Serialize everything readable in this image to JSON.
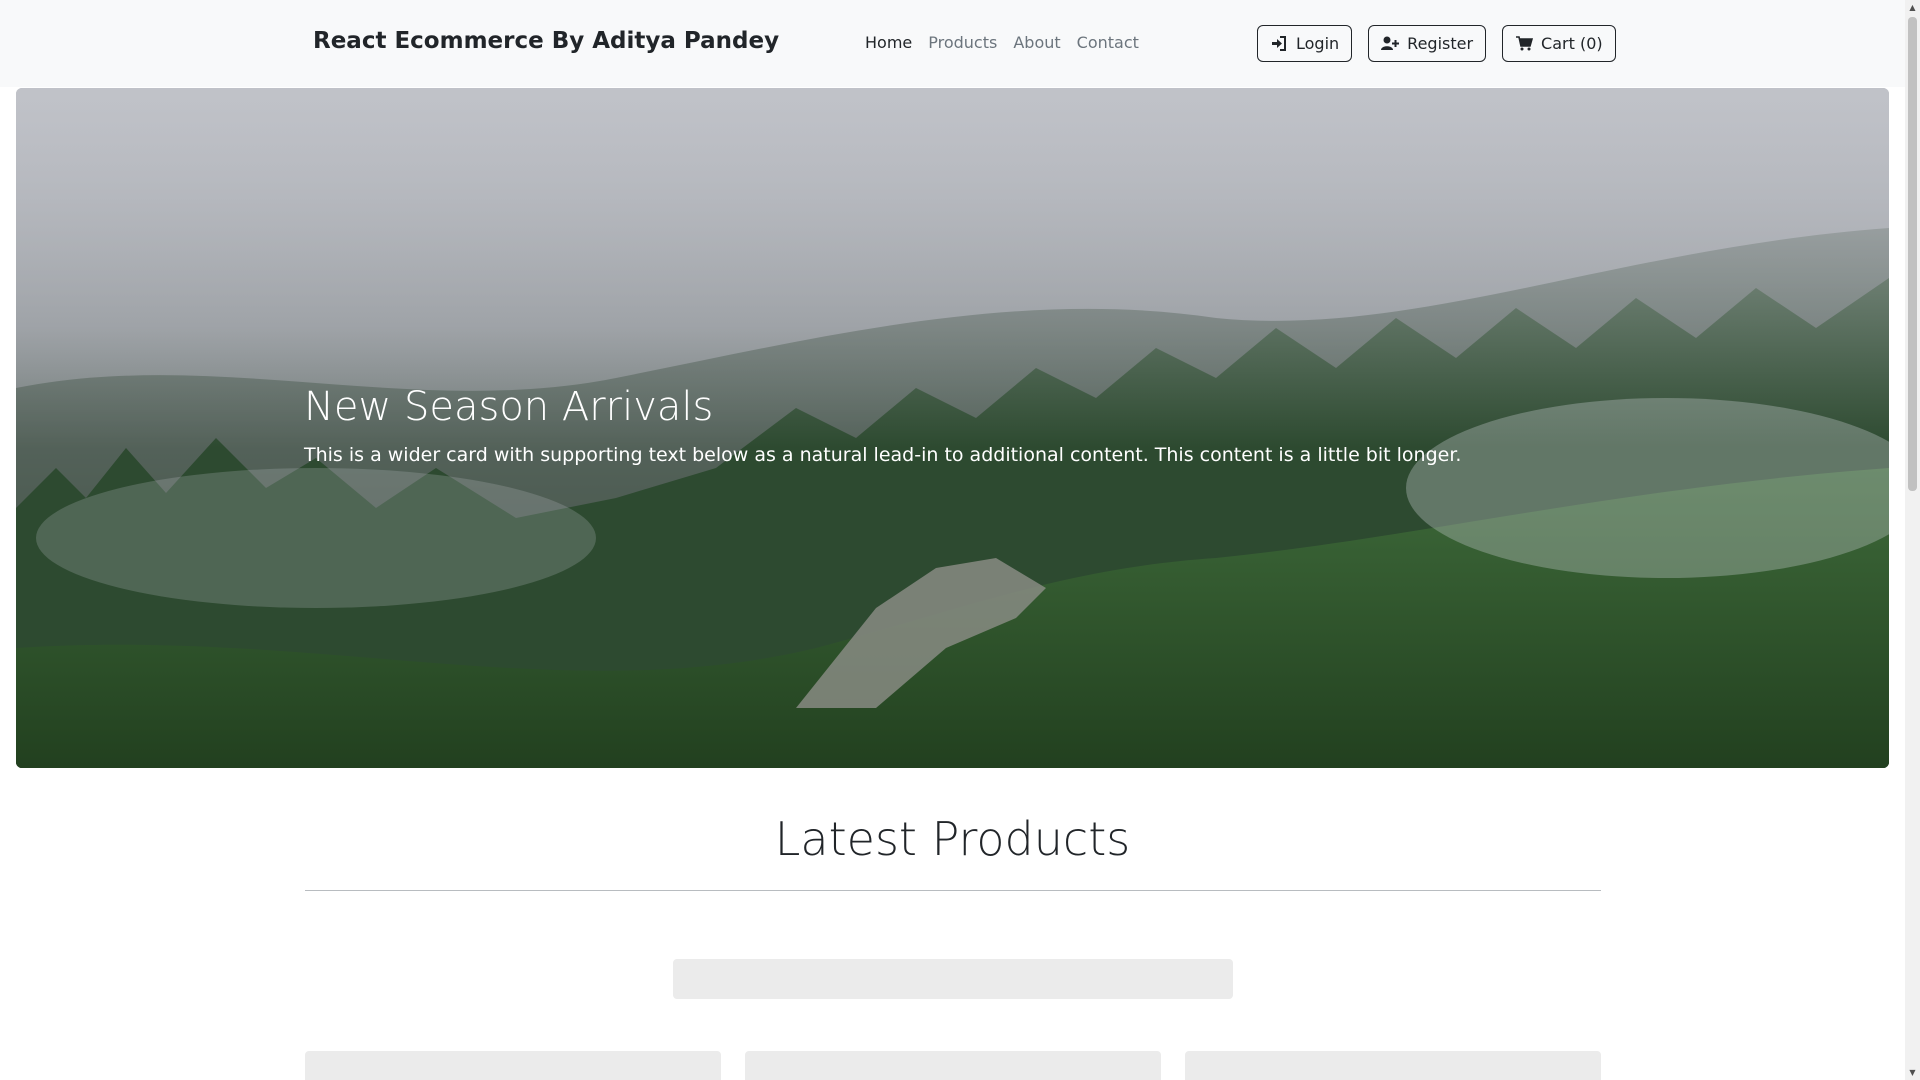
{
  "navbar": {
    "brand": "React Ecommerce By Aditya Pandey",
    "links": [
      {
        "label": "Home",
        "active": true
      },
      {
        "label": "Products",
        "active": false
      },
      {
        "label": "About",
        "active": false
      },
      {
        "label": "Contact",
        "active": false
      }
    ],
    "buttons": {
      "login": {
        "label": "Login",
        "icon": "sign-in-icon"
      },
      "register": {
        "label": "Register",
        "icon": "user-plus-icon"
      },
      "cart": {
        "label": "Cart (0)",
        "icon": "shopping-cart-icon"
      }
    }
  },
  "hero": {
    "title": "New Season Arrivals",
    "text": "This is a wider card with supporting text below as a natural lead-in to additional content. This content is a little bit longer.",
    "image": "misty forest hillside"
  },
  "products": {
    "heading": "Latest Products"
  },
  "colors": {
    "navbar_bg": "#f8f9fa",
    "text": "#212529",
    "muted": "#6c757d",
    "skeleton": "#ebebeb"
  }
}
